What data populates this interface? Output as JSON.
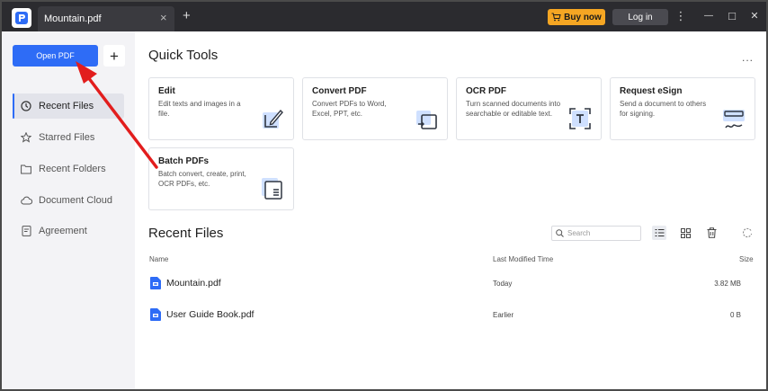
{
  "titlebar": {
    "tab_title": "Mountain.pdf",
    "tab_close_glyph": "×",
    "new_tab_glyph": "+",
    "buy_label": "Buy now",
    "login_label": "Log in",
    "menu_glyph": "⋮",
    "minimize_glyph": "—",
    "maximize_glyph": "□",
    "close_glyph": "✕"
  },
  "sidebar": {
    "open_pdf_label": "Open PDF",
    "add_glyph": "+",
    "items": [
      {
        "label": "Recent Files",
        "icon": "clock-icon",
        "active": true
      },
      {
        "label": "Starred Files",
        "icon": "star-icon",
        "active": false
      },
      {
        "label": "Recent Folders",
        "icon": "folder-icon",
        "active": false
      },
      {
        "label": "Document Cloud",
        "icon": "cloud-icon",
        "active": false
      },
      {
        "label": "Agreement",
        "icon": "agreement-icon",
        "active": false
      }
    ]
  },
  "quick_tools": {
    "title": "Quick Tools",
    "more_glyph": "...",
    "tools": [
      {
        "title": "Edit",
        "desc": "Edit texts and images in a file.",
        "icon": "edit-icon"
      },
      {
        "title": "Convert PDF",
        "desc": "Convert PDFs to Word, Excel, PPT, etc.",
        "icon": "convert-icon"
      },
      {
        "title": "OCR PDF",
        "desc": "Turn scanned documents into searchable or editable text.",
        "icon": "ocr-icon"
      },
      {
        "title": "Request eSign",
        "desc": "Send a document to others for signing.",
        "icon": "esign-icon"
      },
      {
        "title": "Batch PDFs",
        "desc": "Batch convert, create, print, OCR PDFs, etc.",
        "icon": "batch-icon"
      }
    ]
  },
  "recent_files": {
    "title": "Recent Files",
    "search_placeholder": "Search",
    "columns": {
      "name": "Name",
      "modified": "Last Modified Time",
      "size": "Size"
    },
    "files": [
      {
        "name": "Mountain.pdf",
        "modified": "Today",
        "size": "3.82 MB"
      },
      {
        "name": "User Guide Book.pdf",
        "modified": "Earlier",
        "size": "0 B"
      }
    ]
  },
  "colors": {
    "accent": "#2e6cf6",
    "buy": "#f5a623",
    "titlebar": "#2b2b2f",
    "annotation_arrow": "#e21d1d"
  }
}
